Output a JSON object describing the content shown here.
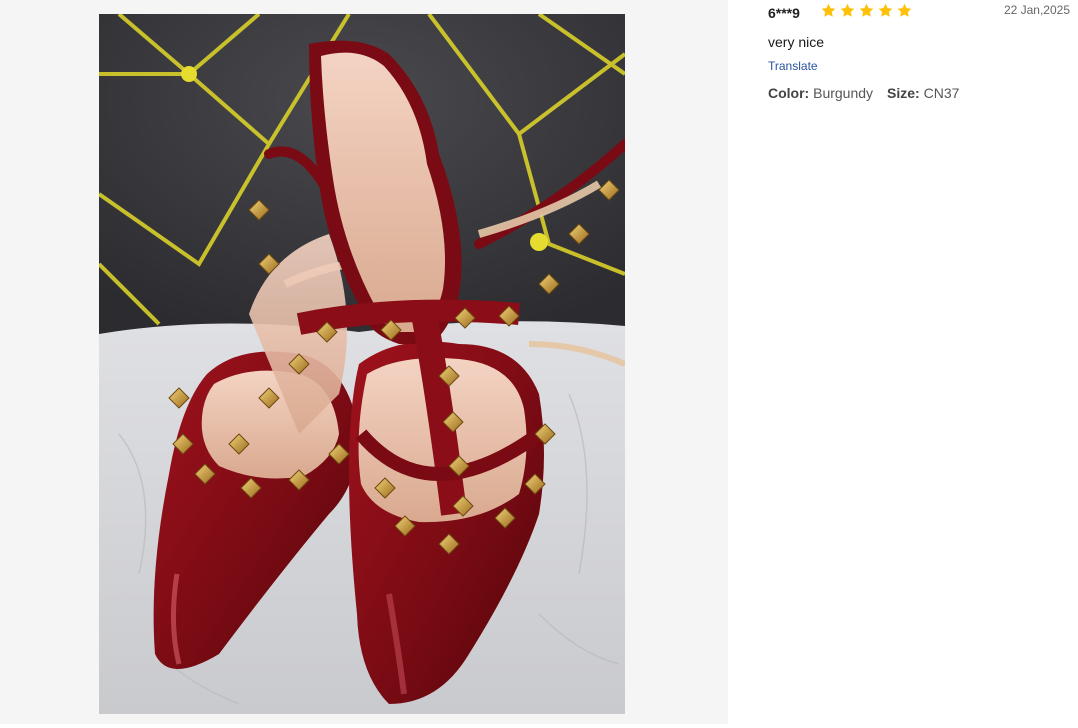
{
  "review": {
    "reviewer": "6***9",
    "rating": 5,
    "rating_max": 5,
    "date": "22 Jan,2025",
    "text": "very nice",
    "translate_label": "Translate",
    "attributes": {
      "color_label": "Color:",
      "color_value": "Burgundy",
      "size_label": "Size:",
      "size_value": "CN37"
    }
  },
  "colors": {
    "star": "#ffc107",
    "link": "#2b55a0",
    "pane_bg": "#f5f5f5"
  },
  "icons": {
    "star": "star-icon"
  }
}
